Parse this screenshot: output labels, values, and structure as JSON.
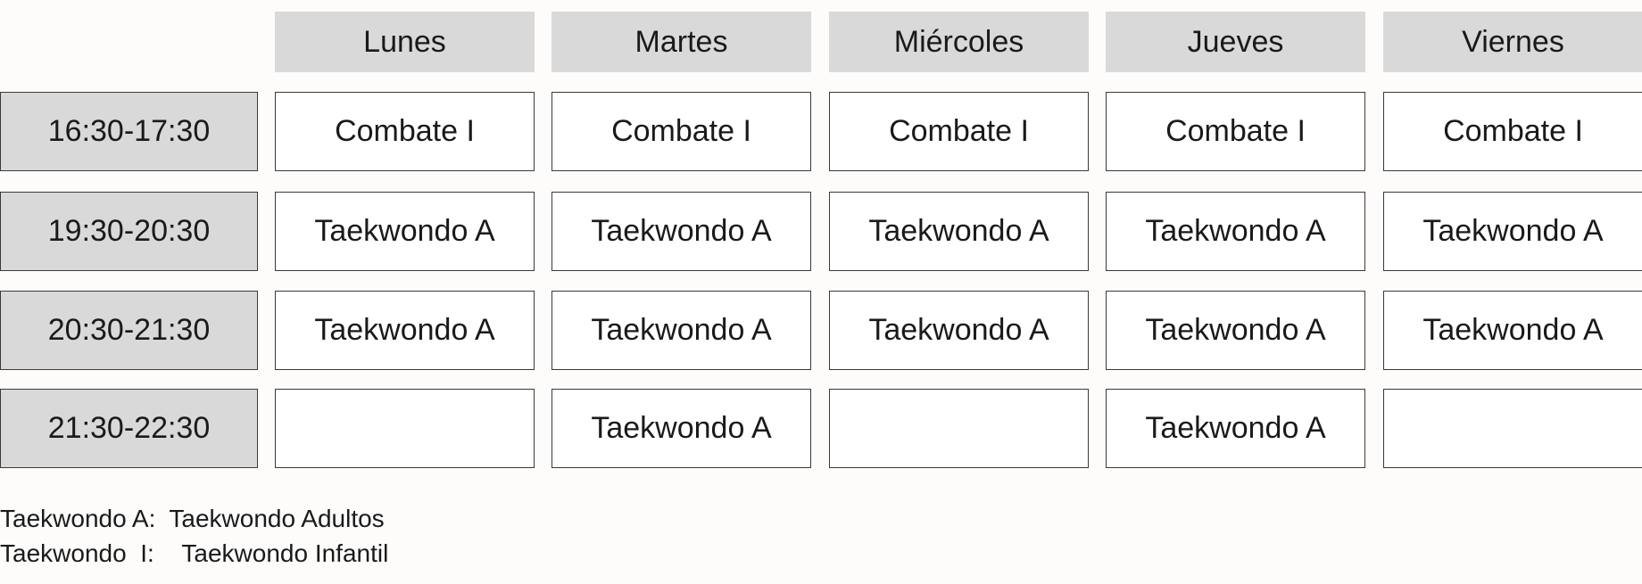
{
  "days": [
    "Lunes",
    "Martes",
    "Miércoles",
    "Jueves",
    "Viernes"
  ],
  "rows": [
    {
      "time": "16:30-17:30",
      "slots": [
        "Combate I",
        "Combate I",
        "Combate I",
        "Combate I",
        "Combate I"
      ]
    },
    {
      "time": "19:30-20:30",
      "slots": [
        "Taekwondo A",
        "Taekwondo A",
        "Taekwondo A",
        "Taekwondo A",
        "Taekwondo A"
      ]
    },
    {
      "time": "20:30-21:30",
      "slots": [
        "Taekwondo A",
        "Taekwondo A",
        "Taekwondo A",
        "Taekwondo A",
        "Taekwondo A"
      ]
    },
    {
      "time": "21:30-22:30",
      "slots": [
        "",
        "Taekwondo A",
        "",
        "Taekwondo A",
        ""
      ]
    }
  ],
  "legend": [
    "Taekwondo A:  Taekwondo Adultos",
    "Taekwondo  I:    Taekwondo Infantil"
  ]
}
